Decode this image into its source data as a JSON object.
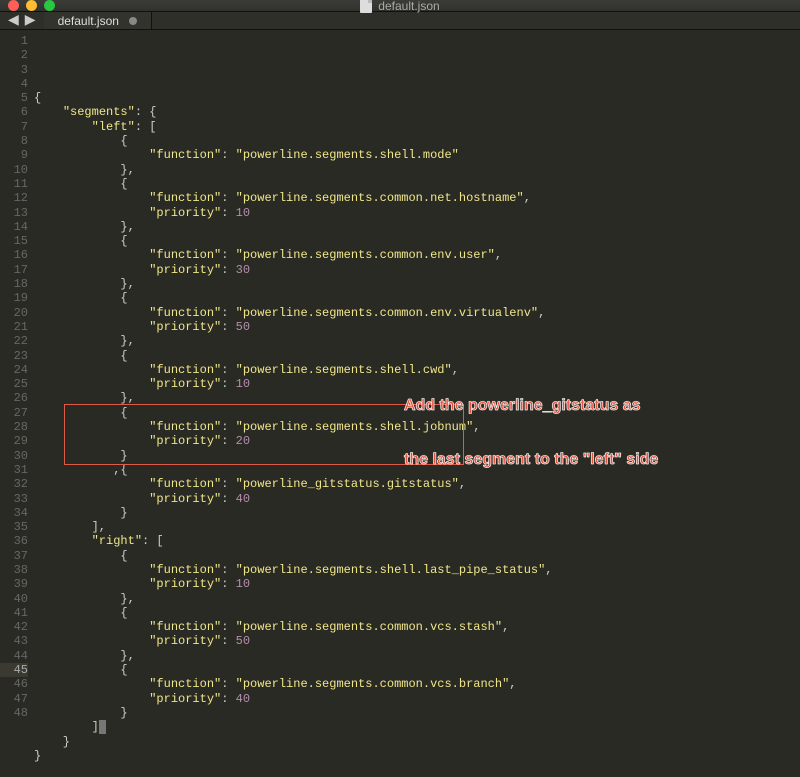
{
  "window": {
    "title": "default.json"
  },
  "tab": {
    "label": "default.json",
    "modified": true
  },
  "annotation": {
    "line1": "Add the powerline_gitstatus as",
    "line2": "the last segment to the \"left\" side"
  },
  "highlight_box": {
    "top_line": 27,
    "bottom_line": 30
  },
  "code_lines": [
    [
      [
        "p",
        "{"
      ]
    ],
    [
      [
        "p",
        "    "
      ],
      [
        "k",
        "\"segments\""
      ],
      [
        "p",
        ": {"
      ]
    ],
    [
      [
        "p",
        "        "
      ],
      [
        "k",
        "\"left\""
      ],
      [
        "p",
        ": ["
      ]
    ],
    [
      [
        "p",
        "            {"
      ]
    ],
    [
      [
        "p",
        "                "
      ],
      [
        "k",
        "\"function\""
      ],
      [
        "p",
        ": "
      ],
      [
        "s",
        "\"powerline.segments.shell.mode\""
      ]
    ],
    [
      [
        "p",
        "            },"
      ]
    ],
    [
      [
        "p",
        "            {"
      ]
    ],
    [
      [
        "p",
        "                "
      ],
      [
        "k",
        "\"function\""
      ],
      [
        "p",
        ": "
      ],
      [
        "s",
        "\"powerline.segments.common.net.hostname\""
      ],
      [
        "p",
        ","
      ]
    ],
    [
      [
        "p",
        "                "
      ],
      [
        "k",
        "\"priority\""
      ],
      [
        "p",
        ": "
      ],
      [
        "n",
        "10"
      ]
    ],
    [
      [
        "p",
        "            },"
      ]
    ],
    [
      [
        "p",
        "            {"
      ]
    ],
    [
      [
        "p",
        "                "
      ],
      [
        "k",
        "\"function\""
      ],
      [
        "p",
        ": "
      ],
      [
        "s",
        "\"powerline.segments.common.env.user\""
      ],
      [
        "p",
        ","
      ]
    ],
    [
      [
        "p",
        "                "
      ],
      [
        "k",
        "\"priority\""
      ],
      [
        "p",
        ": "
      ],
      [
        "n",
        "30"
      ]
    ],
    [
      [
        "p",
        "            },"
      ]
    ],
    [
      [
        "p",
        "            {"
      ]
    ],
    [
      [
        "p",
        "                "
      ],
      [
        "k",
        "\"function\""
      ],
      [
        "p",
        ": "
      ],
      [
        "s",
        "\"powerline.segments.common.env.virtualenv\""
      ],
      [
        "p",
        ","
      ]
    ],
    [
      [
        "p",
        "                "
      ],
      [
        "k",
        "\"priority\""
      ],
      [
        "p",
        ": "
      ],
      [
        "n",
        "50"
      ]
    ],
    [
      [
        "p",
        "            },"
      ]
    ],
    [
      [
        "p",
        "            {"
      ]
    ],
    [
      [
        "p",
        "                "
      ],
      [
        "k",
        "\"function\""
      ],
      [
        "p",
        ": "
      ],
      [
        "s",
        "\"powerline.segments.shell.cwd\""
      ],
      [
        "p",
        ","
      ]
    ],
    [
      [
        "p",
        "                "
      ],
      [
        "k",
        "\"priority\""
      ],
      [
        "p",
        ": "
      ],
      [
        "n",
        "10"
      ]
    ],
    [
      [
        "p",
        "            },"
      ]
    ],
    [
      [
        "p",
        "            {"
      ]
    ],
    [
      [
        "p",
        "                "
      ],
      [
        "k",
        "\"function\""
      ],
      [
        "p",
        ": "
      ],
      [
        "s",
        "\"powerline.segments.shell.jobnum\""
      ],
      [
        "p",
        ","
      ]
    ],
    [
      [
        "p",
        "                "
      ],
      [
        "k",
        "\"priority\""
      ],
      [
        "p",
        ": "
      ],
      [
        "n",
        "20"
      ]
    ],
    [
      [
        "p",
        "            }"
      ]
    ],
    [
      [
        "p",
        "           ,{"
      ]
    ],
    [
      [
        "p",
        "                "
      ],
      [
        "k",
        "\"function\""
      ],
      [
        "p",
        ": "
      ],
      [
        "s",
        "\"powerline_gitstatus.gitstatus\""
      ],
      [
        "p",
        ","
      ]
    ],
    [
      [
        "p",
        "                "
      ],
      [
        "k",
        "\"priority\""
      ],
      [
        "p",
        ": "
      ],
      [
        "n",
        "40"
      ]
    ],
    [
      [
        "p",
        "            }"
      ]
    ],
    [
      [
        "p",
        "        ],"
      ]
    ],
    [
      [
        "p",
        "        "
      ],
      [
        "k",
        "\"right\""
      ],
      [
        "p",
        ": ["
      ]
    ],
    [
      [
        "p",
        "            {"
      ]
    ],
    [
      [
        "p",
        "                "
      ],
      [
        "k",
        "\"function\""
      ],
      [
        "p",
        ": "
      ],
      [
        "s",
        "\"powerline.segments.shell.last_pipe_status\""
      ],
      [
        "p",
        ","
      ]
    ],
    [
      [
        "p",
        "                "
      ],
      [
        "k",
        "\"priority\""
      ],
      [
        "p",
        ": "
      ],
      [
        "n",
        "10"
      ]
    ],
    [
      [
        "p",
        "            },"
      ]
    ],
    [
      [
        "p",
        "            {"
      ]
    ],
    [
      [
        "p",
        "                "
      ],
      [
        "k",
        "\"function\""
      ],
      [
        "p",
        ": "
      ],
      [
        "s",
        "\"powerline.segments.common.vcs.stash\""
      ],
      [
        "p",
        ","
      ]
    ],
    [
      [
        "p",
        "                "
      ],
      [
        "k",
        "\"priority\""
      ],
      [
        "p",
        ": "
      ],
      [
        "n",
        "50"
      ]
    ],
    [
      [
        "p",
        "            },"
      ]
    ],
    [
      [
        "p",
        "            {"
      ]
    ],
    [
      [
        "p",
        "                "
      ],
      [
        "k",
        "\"function\""
      ],
      [
        "p",
        ": "
      ],
      [
        "s",
        "\"powerline.segments.common.vcs.branch\""
      ],
      [
        "p",
        ","
      ]
    ],
    [
      [
        "p",
        "                "
      ],
      [
        "k",
        "\"priority\""
      ],
      [
        "p",
        ": "
      ],
      [
        "n",
        "40"
      ]
    ],
    [
      [
        "p",
        "            }"
      ]
    ],
    [
      [
        "p",
        "        ]|"
      ]
    ],
    [
      [
        "p",
        "    }"
      ]
    ],
    [
      [
        "p",
        "}"
      ]
    ],
    [
      [
        "p",
        ""
      ]
    ]
  ],
  "json_content": {
    "segments": {
      "left": [
        {
          "function": "powerline.segments.shell.mode"
        },
        {
          "function": "powerline.segments.common.net.hostname",
          "priority": 10
        },
        {
          "function": "powerline.segments.common.env.user",
          "priority": 30
        },
        {
          "function": "powerline.segments.common.env.virtualenv",
          "priority": 50
        },
        {
          "function": "powerline.segments.shell.cwd",
          "priority": 10
        },
        {
          "function": "powerline.segments.shell.jobnum",
          "priority": 20
        },
        {
          "function": "powerline_gitstatus.gitstatus",
          "priority": 40
        }
      ],
      "right": [
        {
          "function": "powerline.segments.shell.last_pipe_status",
          "priority": 10
        },
        {
          "function": "powerline.segments.common.vcs.stash",
          "priority": 50
        },
        {
          "function": "powerline.segments.common.vcs.branch",
          "priority": 40
        }
      ]
    }
  }
}
